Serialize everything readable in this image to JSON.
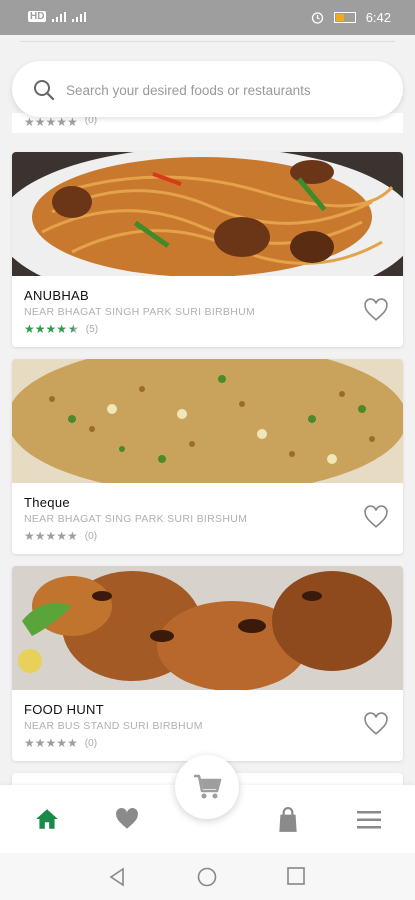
{
  "status_bar": {
    "left_text": "HD",
    "time": "6:42"
  },
  "search": {
    "placeholder": "Search your desired foods or restaurants"
  },
  "partial_card": {
    "rating_count": "(0)"
  },
  "restaurants": [
    {
      "name": "ANUBHAB",
      "address": "NEAR BHAGAT SINGH PARK SURI BIRBHUM",
      "rating": 4.5,
      "rating_count": "(5)",
      "star_color": "#2e9d4e",
      "image": "noodles-dish"
    },
    {
      "name": "Theque",
      "address": "NEAR BHAGAT SING PARK SURI BIRSHUM",
      "rating": 0,
      "rating_count": "(0)",
      "star_color": "#9e9e9e",
      "image": "fried-rice-dish"
    },
    {
      "name": "FOOD HUNT",
      "address": "NEAR BUS STAND SURI BIRBHUM",
      "rating": 0,
      "rating_count": "(0)",
      "star_color": "#9e9e9e",
      "image": "grilled-chicken-dish"
    }
  ],
  "bottom_nav": {
    "active_color": "#1a8a4a",
    "inactive_color": "#8a8a8a",
    "items": [
      "home-icon",
      "heart-icon",
      "cart-icon",
      "bag-icon",
      "menu-icon"
    ]
  }
}
